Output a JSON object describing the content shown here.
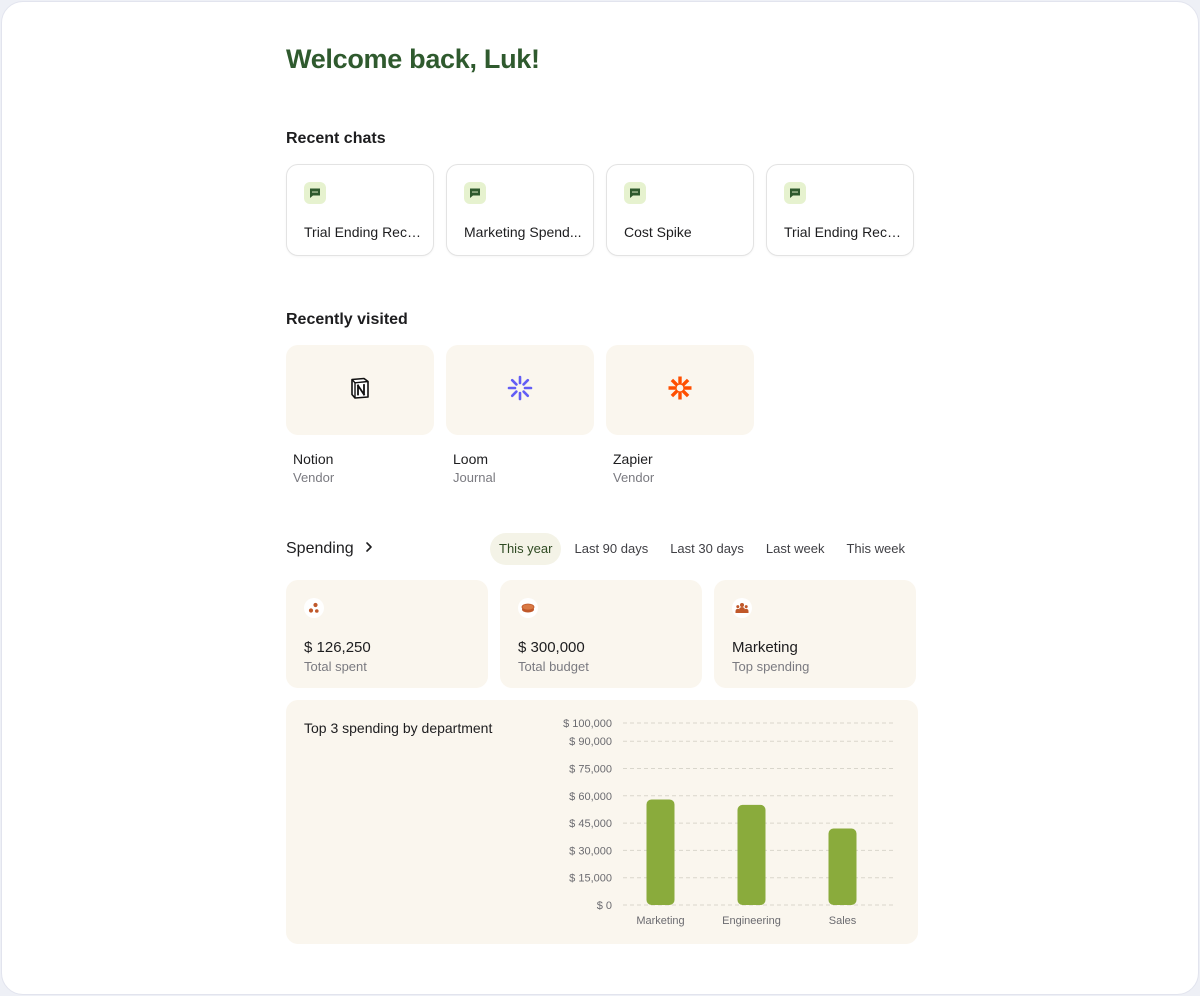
{
  "greeting": "Welcome back, Luk!",
  "recent_chats": {
    "title": "Recent chats",
    "items": [
      {
        "label": "Trial Ending Reco..."
      },
      {
        "label": "Marketing Spend..."
      },
      {
        "label": "Cost Spike"
      },
      {
        "label": "Trial Ending Reco..."
      }
    ]
  },
  "recently_visited": {
    "title": "Recently visited",
    "items": [
      {
        "name": "Notion",
        "type": "Vendor",
        "icon": "notion-logo-icon"
      },
      {
        "name": "Loom",
        "type": "Journal",
        "icon": "loom-logo-icon"
      },
      {
        "name": "Zapier",
        "type": "Vendor",
        "icon": "zapier-logo-icon"
      }
    ]
  },
  "spending": {
    "title": "Spending",
    "tabs": [
      {
        "label": "This year",
        "active": true
      },
      {
        "label": "Last 90 days",
        "active": false
      },
      {
        "label": "Last 30 days",
        "active": false
      },
      {
        "label": "Last week",
        "active": false
      },
      {
        "label": "This week",
        "active": false
      }
    ],
    "stats": [
      {
        "value": "$ 126,250",
        "label": "Total spent",
        "icon": "dots-icon"
      },
      {
        "value": "$ 300,000",
        "label": "Total budget",
        "icon": "coins-icon"
      },
      {
        "value": "Marketing",
        "label": "Top spending",
        "icon": "people-icon"
      }
    ]
  },
  "colors": {
    "brand_green": "#2f5a2e",
    "bar_green": "#8aab3c",
    "card_bg": "#faf6ee",
    "chat_icon_bg": "#e6f2cf",
    "accent_orange": "#c0582a"
  },
  "chart_data": {
    "type": "bar",
    "title": "Top 3 spending by department",
    "categories": [
      "Marketing",
      "Engineering",
      "Sales"
    ],
    "values": [
      58000,
      55000,
      42000
    ],
    "ylim": [
      0,
      100000
    ],
    "yticks": [
      0,
      15000,
      30000,
      45000,
      60000,
      75000,
      90000,
      100000
    ],
    "ytick_labels": [
      "$ 0",
      "$ 15,000",
      "$ 30,000",
      "$ 45,000",
      "$ 60,000",
      "$ 75,000",
      "$ 90,000",
      "$ 100,000"
    ],
    "grid": true
  }
}
